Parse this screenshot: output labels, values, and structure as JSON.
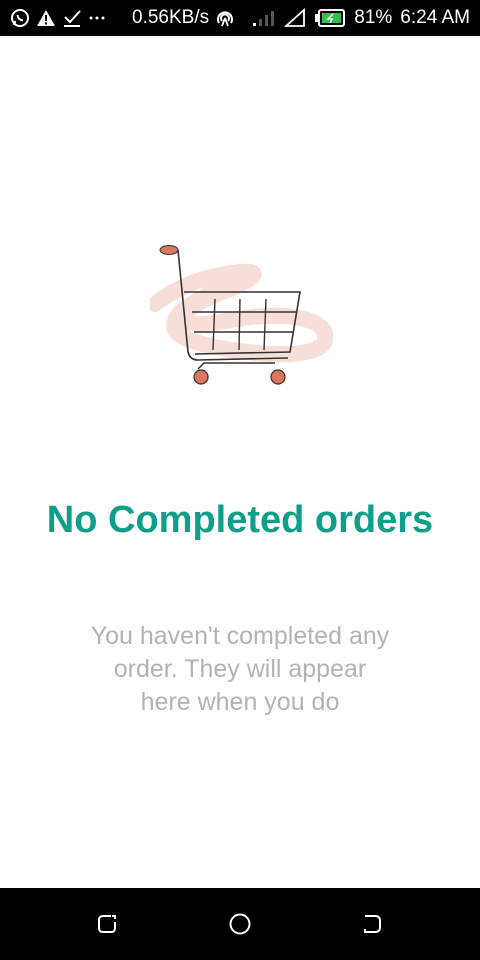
{
  "status_bar": {
    "net_speed": "0.56KB/s",
    "battery": "81%",
    "time": "6:24 AM",
    "icons": [
      "whatsapp-icon",
      "warning-icon",
      "download-done-icon",
      "more-notifications-icon",
      "hotspot-icon",
      "signal-icon",
      "no-signal-icon",
      "battery-charging-icon"
    ]
  },
  "empty_state": {
    "illustration": "shopping-cart-illustration",
    "title": "No Completed orders",
    "message": "You haven't completed any order. They will appear here when you do"
  },
  "nav_bar": {
    "buttons": [
      "back",
      "home",
      "recent-apps"
    ]
  },
  "colors": {
    "title": "#0e9f8a",
    "message": "#b3b3b3",
    "cart_accent": "#d9785c",
    "cart_splash": "#f7ded8"
  }
}
